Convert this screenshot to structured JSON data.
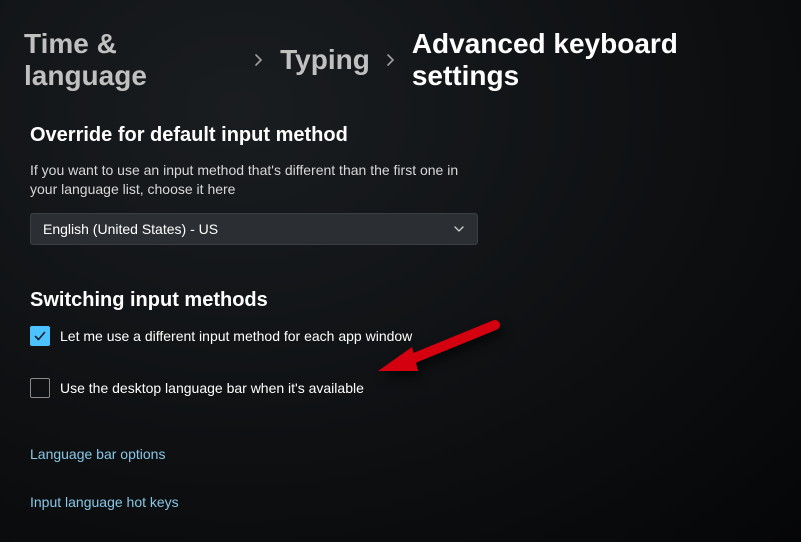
{
  "breadcrumb": {
    "items": [
      {
        "label": "Time & language"
      },
      {
        "label": "Typing"
      },
      {
        "label": "Advanced keyboard settings"
      }
    ]
  },
  "override": {
    "title": "Override for default input method",
    "desc": "If you want to use an input method that's different than the first one in your language list, choose it here",
    "dropdown_selected": "English (United States) - US"
  },
  "switching": {
    "title": "Switching input methods",
    "checkbox_per_app": {
      "label": "Let me use a different input method for each app window",
      "checked": true
    },
    "checkbox_lang_bar": {
      "label": "Use the desktop language bar when it's available",
      "checked": false
    }
  },
  "links": {
    "lang_bar_options": "Language bar options",
    "input_hotkeys": "Input language hot keys"
  }
}
